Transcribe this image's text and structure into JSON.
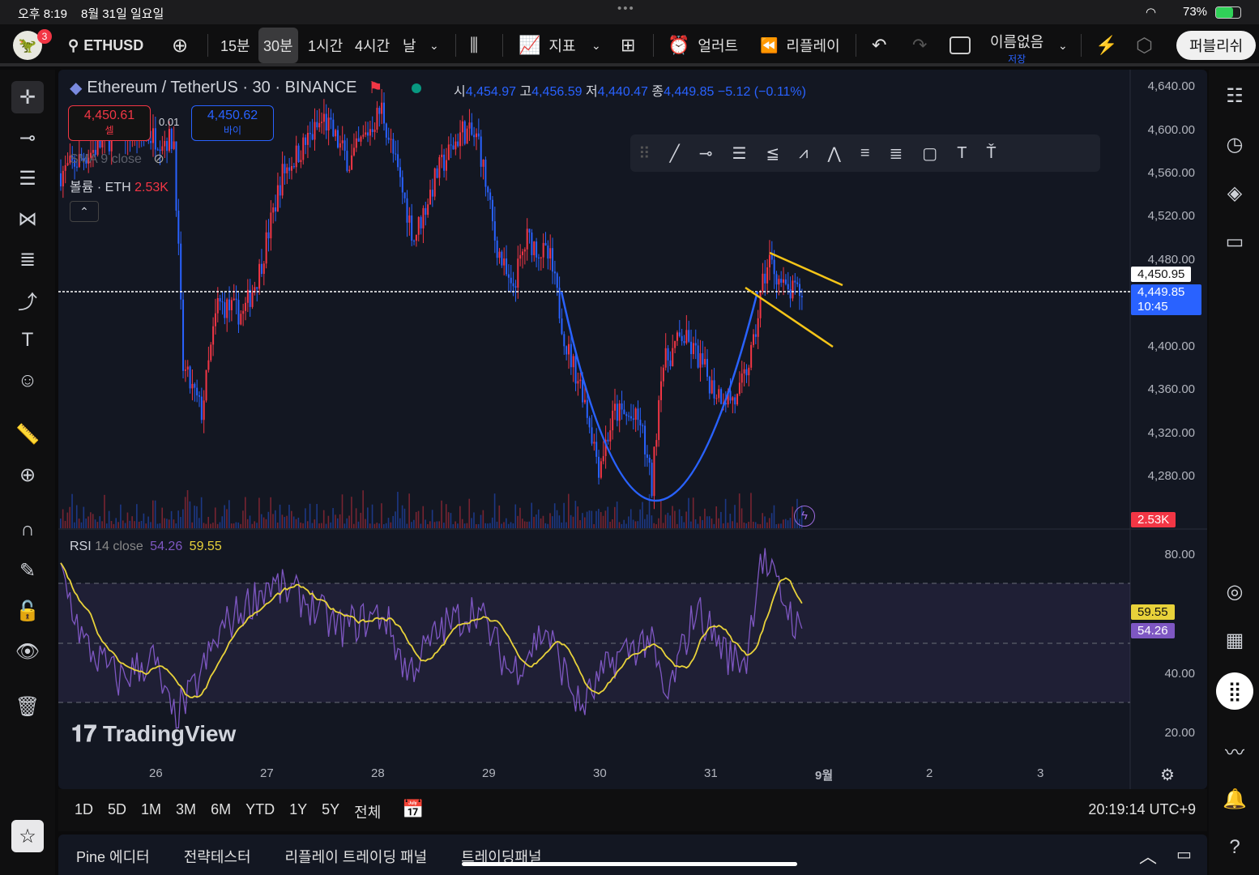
{
  "status": {
    "time": "오후 8:19",
    "date": "8월 31일 일요일",
    "battery": "73%"
  },
  "toolbar": {
    "notif_count": "3",
    "symbol": "ETHUSD",
    "intervals": [
      "15분",
      "30분",
      "1시간",
      "4시간",
      "날"
    ],
    "active_interval": "30분",
    "indicators": "지표",
    "alert": "얼러트",
    "replay": "리플레이",
    "layout_name": "이름없음",
    "save": "저장",
    "publish": "퍼블리쉬"
  },
  "legend": {
    "title": "Ethereum / TetherUS · 30 · BINANCE",
    "o_label": "시",
    "o": "4,454.97",
    "h_label": "고",
    "h": "4,456.59",
    "l_label": "저",
    "l": "4,440.47",
    "c_label": "종",
    "c": "4,449.85",
    "change": "−5.12 (−0.11%)",
    "sell_price": "4,450.61",
    "sell_label": "셀",
    "spread": "0.01",
    "buy_price": "4,450.62",
    "buy_label": "바이",
    "sma": "SMA 9 close",
    "volume_label": "볼륨 · ETH",
    "volume_value": "2.53K"
  },
  "price_axis": {
    "ticks": [
      "4,640.00",
      "4,600.00",
      "4,560.00",
      "4,520.00",
      "4,480.00",
      "4,400.00",
      "4,360.00",
      "4,320.00",
      "4,280.00"
    ],
    "crosshair_price": "4,450.95",
    "last_price": "4,449.85",
    "countdown": "10:45",
    "volume_tag": "2.53K"
  },
  "rsi": {
    "label": "RSI",
    "params": "14 close",
    "value": "54.26",
    "ma_value": "59.55",
    "ticks": [
      "80.00",
      "40.00",
      "20.00"
    ]
  },
  "time_axis": [
    "26",
    "27",
    "28",
    "29",
    "30",
    "31",
    "9월",
    "2",
    "3"
  ],
  "watermark": "TradingView",
  "ranges": [
    "1D",
    "5D",
    "1M",
    "3M",
    "6M",
    "YTD",
    "1Y",
    "5Y",
    "전체"
  ],
  "clock": "20:19:14 UTC+9",
  "panels": [
    "Pine 에디터",
    "전략테스터",
    "리플레이 트레이딩 패널",
    "트레이딩패널"
  ],
  "colors": {
    "up": "#f23645",
    "down": "#2962ff",
    "bg": "#131722",
    "rsi": "#7e57c2",
    "rsi_ma": "#e8d23a",
    "accent": "#2962ff"
  },
  "chart_data": {
    "type": "candlestick",
    "interval": "30m",
    "ylim": [
      4260,
      4650
    ],
    "price_path": [
      [
        0,
        4560
      ],
      [
        26,
        4600
      ],
      [
        49,
        4590
      ],
      [
        53,
        4380
      ],
      [
        61,
        4340
      ],
      [
        68,
        4440
      ],
      [
        79,
        4430
      ],
      [
        86,
        4470
      ],
      [
        96,
        4560
      ],
      [
        114,
        4610
      ],
      [
        125,
        4570
      ],
      [
        139,
        4620
      ],
      [
        146,
        4560
      ],
      [
        153,
        4500
      ],
      [
        163,
        4560
      ],
      [
        174,
        4600
      ],
      [
        181,
        4590
      ],
      [
        188,
        4500
      ],
      [
        195,
        4450
      ],
      [
        202,
        4500
      ],
      [
        212,
        4480
      ],
      [
        219,
        4400
      ],
      [
        226,
        4360
      ],
      [
        233,
        4290
      ],
      [
        240,
        4340
      ],
      [
        251,
        4330
      ],
      [
        256,
        4270
      ],
      [
        260,
        4380
      ],
      [
        269,
        4410
      ],
      [
        276,
        4390
      ],
      [
        283,
        4360
      ],
      [
        293,
        4350
      ],
      [
        300,
        4400
      ],
      [
        304,
        4460
      ],
      [
        307,
        4480
      ],
      [
        314,
        4450
      ],
      [
        321,
        4450
      ]
    ],
    "rsi_path": [
      [
        0,
        75
      ],
      [
        10,
        50
      ],
      [
        25,
        38
      ],
      [
        40,
        45
      ],
      [
        48,
        25
      ],
      [
        56,
        32
      ],
      [
        70,
        55
      ],
      [
        90,
        70
      ],
      [
        105,
        65
      ],
      [
        120,
        55
      ],
      [
        140,
        60
      ],
      [
        150,
        40
      ],
      [
        165,
        55
      ],
      [
        180,
        62
      ],
      [
        195,
        40
      ],
      [
        210,
        55
      ],
      [
        225,
        28
      ],
      [
        240,
        45
      ],
      [
        255,
        52
      ],
      [
        262,
        30
      ],
      [
        275,
        62
      ],
      [
        290,
        45
      ],
      [
        297,
        45
      ],
      [
        303,
        80
      ],
      [
        308,
        72
      ],
      [
        315,
        62
      ],
      [
        321,
        52
      ]
    ],
    "rsi_ylim": [
      10,
      90
    ]
  }
}
